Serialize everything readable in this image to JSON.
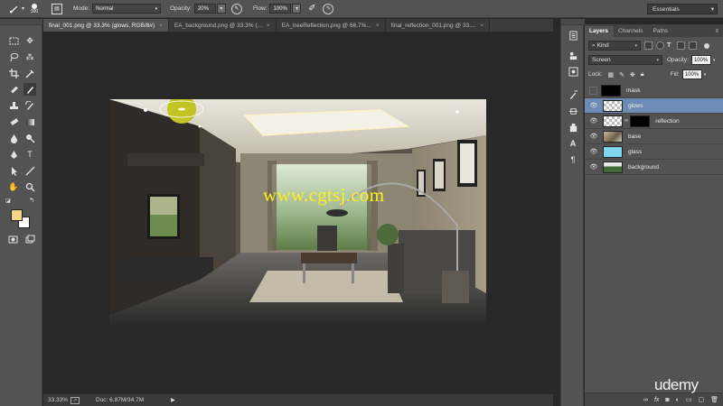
{
  "options_bar": {
    "brush_size": "300",
    "mode_label": "Mode:",
    "mode_value": "Normal",
    "opacity_label": "Opacity:",
    "opacity_value": "20%",
    "flow_label": "Flow:",
    "flow_value": "100%",
    "workspace_value": "Essentials"
  },
  "tabs": [
    {
      "label": "final_001.png @ 33.3% (glows, RGB/8#)",
      "close": "×",
      "active": true
    },
    {
      "label": "EA_background.png @ 33.3% (...",
      "close": "×",
      "active": false
    },
    {
      "label": "EA_treeReflection.png @ 66.7%...",
      "close": "×",
      "active": false
    },
    {
      "label": "final_reflection_001.png @ 33....",
      "close": "×",
      "active": false
    }
  ],
  "canvas": {
    "watermark": "www.cgtsj.com"
  },
  "status_bar": {
    "zoom": "33.33%",
    "doc_info": "Doc: 6.87M/34.7M",
    "arrow": "▶"
  },
  "layers_panel": {
    "tabs": [
      "Layers",
      "Channels",
      "Paths"
    ],
    "kind_label": "Kind",
    "blend_mode": "Screen",
    "opacity_label": "Opacity:",
    "opacity_value": "100%",
    "lock_label": "Lock:",
    "fill_label": "Fill:",
    "fill_value": "100%",
    "layers": [
      {
        "name": "mask",
        "visible": false,
        "thumb": "black"
      },
      {
        "name": "glows",
        "visible": true,
        "thumb": "checker",
        "selected": true
      },
      {
        "name": "reflection",
        "visible": true,
        "thumb": "checker",
        "has_mask": true
      },
      {
        "name": "base",
        "visible": true,
        "thumb": "photo"
      },
      {
        "name": "glass",
        "visible": true,
        "thumb": "glass"
      },
      {
        "name": "background",
        "visible": true,
        "thumb": "bg"
      }
    ]
  },
  "brand": "udemy",
  "colors": {
    "foreground": "#f7d488",
    "background": "#ffffff",
    "selected_layer": "#6e8bb5"
  }
}
